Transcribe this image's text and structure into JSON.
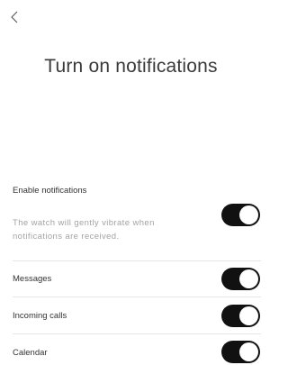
{
  "header": {
    "back_icon": "chevron-left-icon",
    "title": "Turn on notifications"
  },
  "enable": {
    "label": "Enable notifications",
    "description": "The watch will gently vibrate when notifications are received.",
    "on": true
  },
  "rows": [
    {
      "label": "Messages",
      "on": true
    },
    {
      "label": "Incoming calls",
      "on": true
    },
    {
      "label": "Calendar",
      "on": true
    }
  ],
  "colors": {
    "toggle_on": "#111111",
    "knob": "#ffffff",
    "hint_text": "#a3a3a3"
  }
}
